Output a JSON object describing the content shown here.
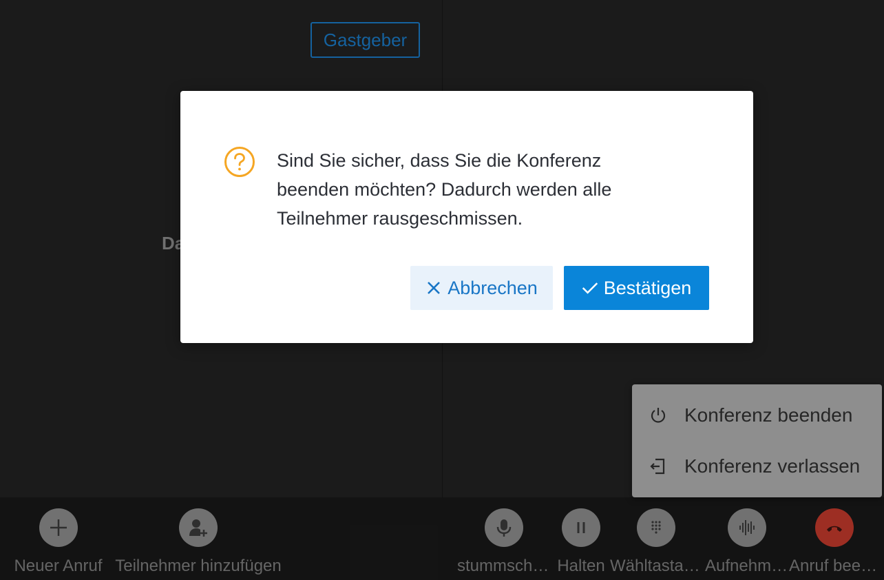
{
  "background": {
    "host_badge": "Gastgeber",
    "participant_name_partial": "Da"
  },
  "dialog": {
    "icon": "question-circle-icon",
    "message": "Sind Sie sicher, dass Sie die Konferenz beenden möchten? Dadurch werden alle Teilnehmer rausgeschmissen.",
    "cancel_label": "Abbrechen",
    "confirm_label": "Bestätigen",
    "colors": {
      "icon": "#f5a623",
      "confirm_bg": "#0a85d9",
      "cancel_bg": "#e9f2fb",
      "cancel_text": "#1976c6"
    }
  },
  "end_menu": {
    "items": [
      {
        "icon": "power-icon",
        "label": "Konferenz beenden"
      },
      {
        "icon": "exit-icon",
        "label": "Konferenz verlassen"
      }
    ]
  },
  "toolbar": {
    "left": [
      {
        "icon": "plus-icon",
        "label": "Neuer Anruf"
      },
      {
        "icon": "add-user-icon",
        "label": "Teilnehmer hinzufügen"
      }
    ],
    "right": [
      {
        "icon": "microphone-icon",
        "label": "stummschalten"
      },
      {
        "icon": "pause-icon",
        "label": "Halten"
      },
      {
        "icon": "dialpad-icon",
        "label": "Wähltastatur"
      },
      {
        "icon": "waveform-icon",
        "label": "Aufnehmen"
      },
      {
        "icon": "hangup-icon",
        "label": "Anruf beenden",
        "color": "#c0392b"
      }
    ]
  }
}
